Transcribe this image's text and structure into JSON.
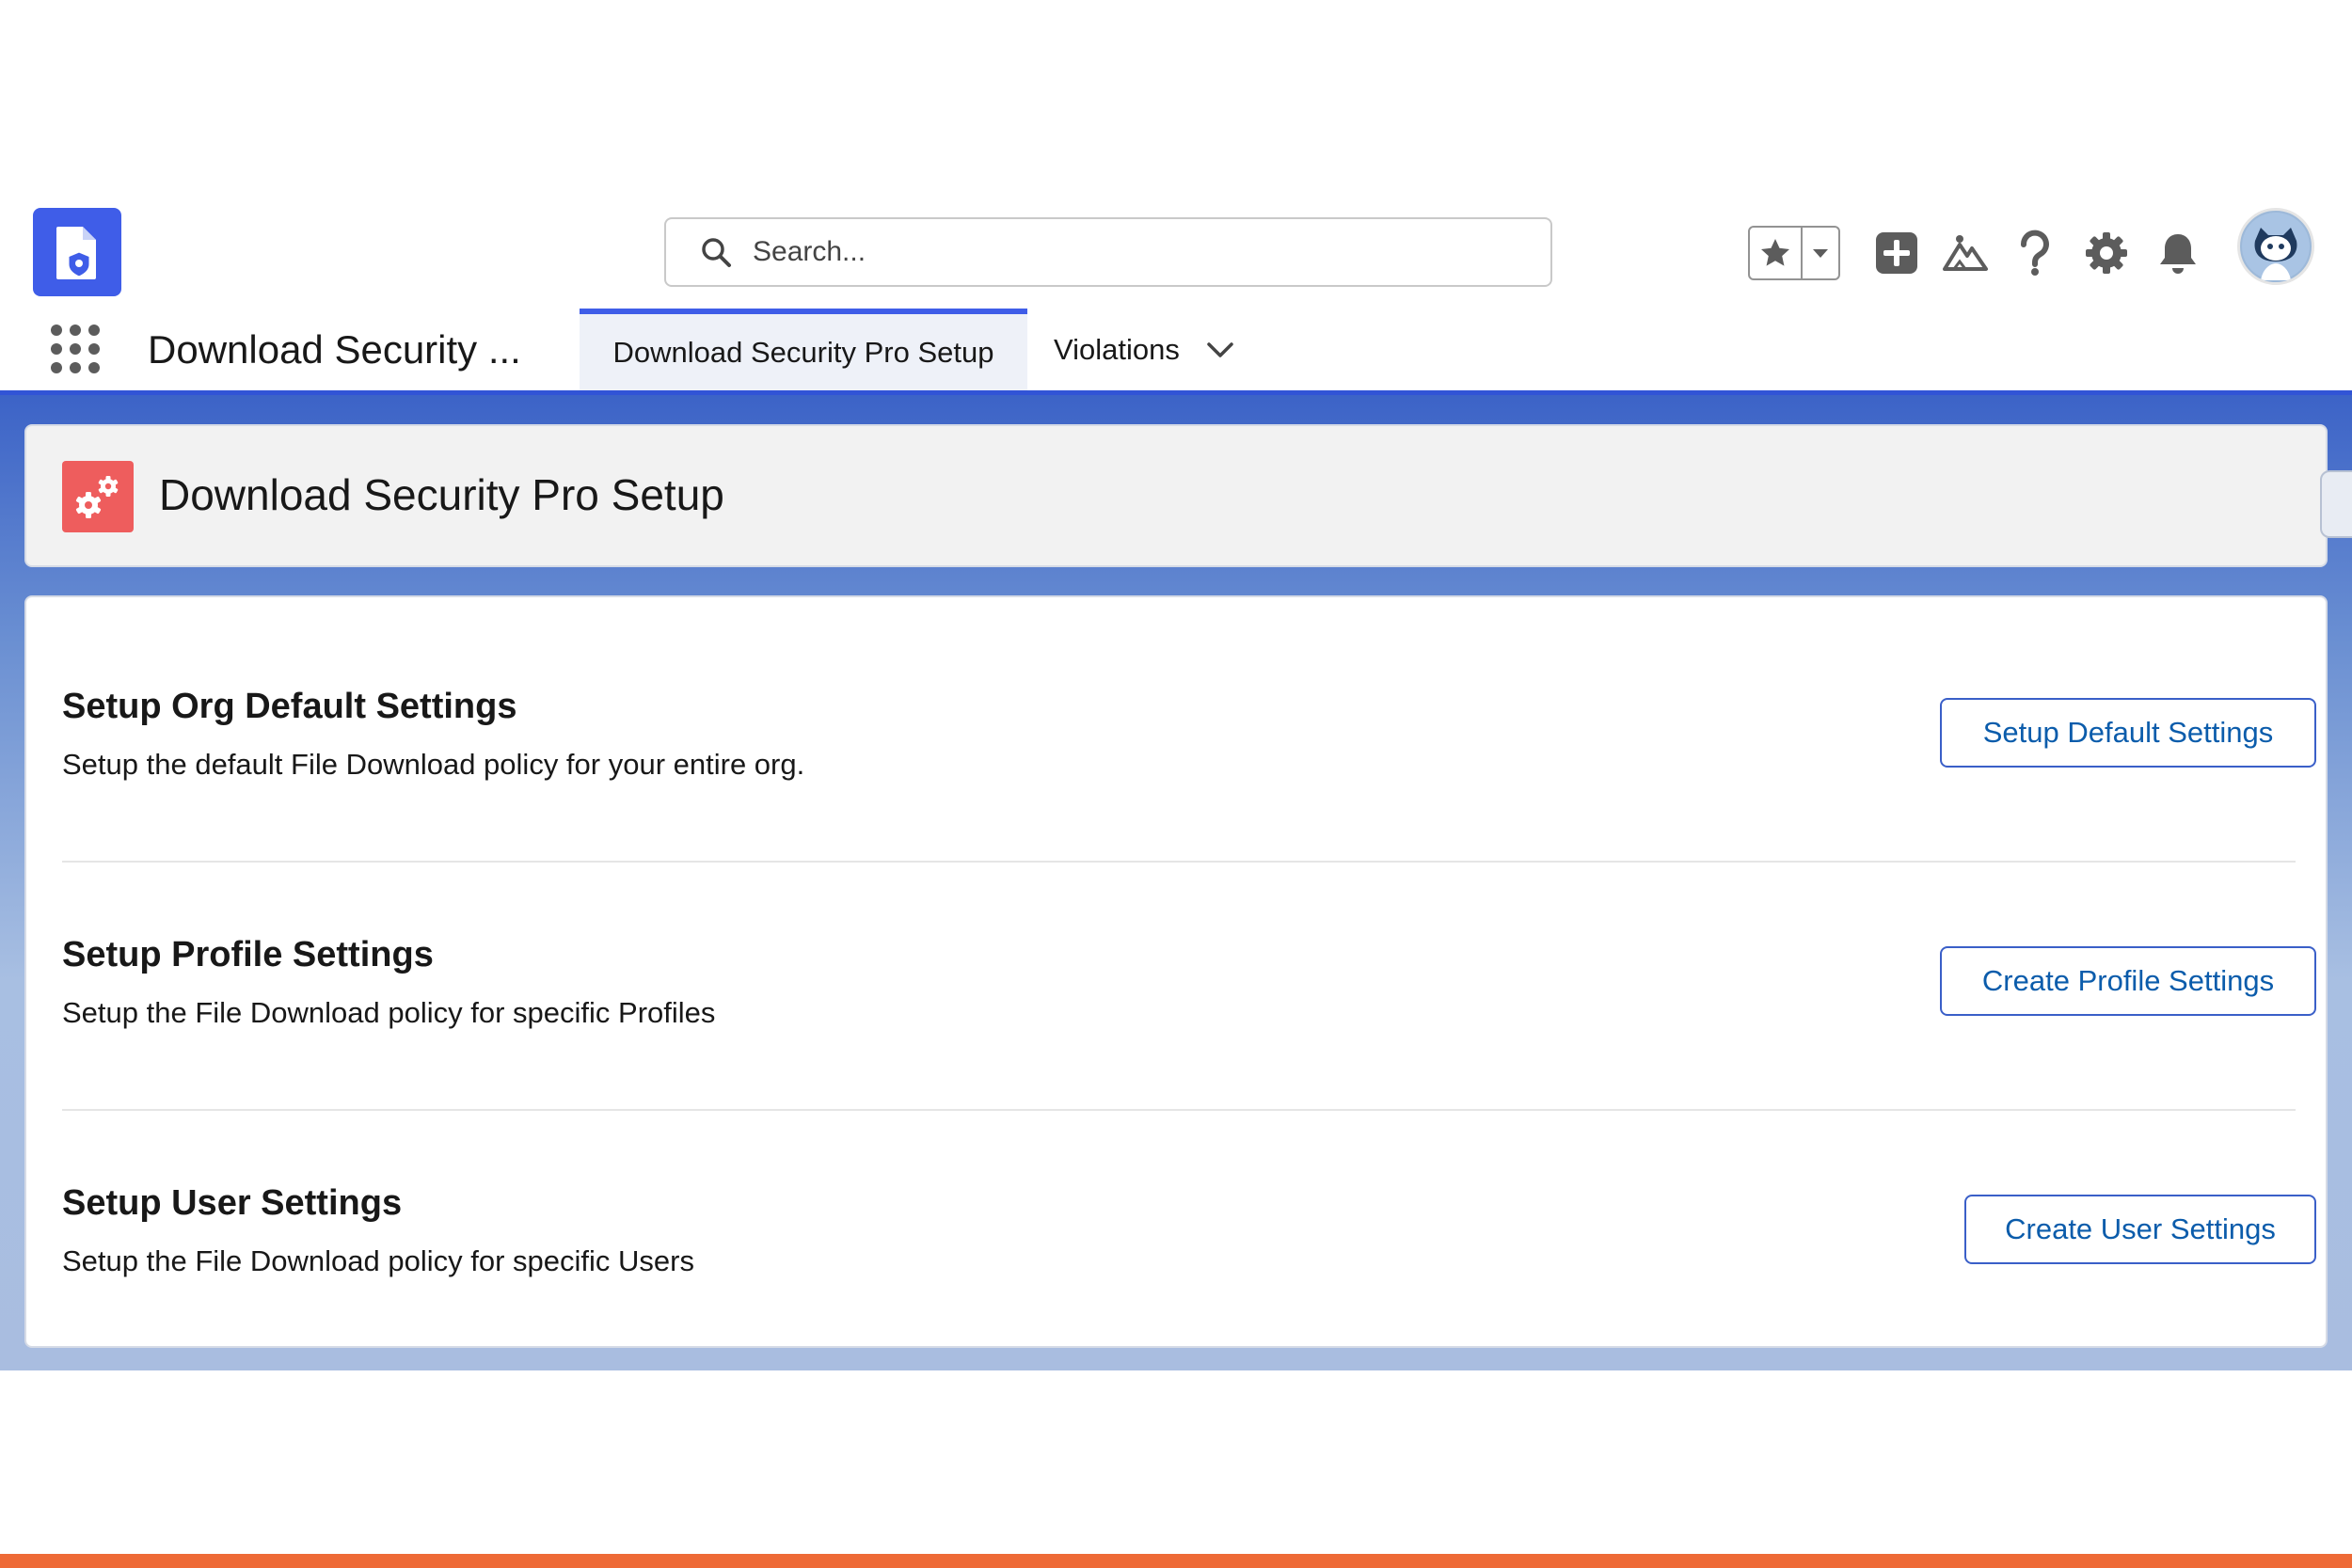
{
  "header": {
    "app_logo_icon": "file-shield-icon",
    "search": {
      "placeholder": "Search..."
    },
    "icons": [
      "star-icon",
      "chevron-down-icon",
      "add-icon",
      "trailhead-icon",
      "help-icon",
      "gear-icon",
      "bell-icon",
      "avatar"
    ]
  },
  "nav": {
    "app_name": "Download Security ...",
    "tabs": [
      {
        "label": "Download Security Pro Setup",
        "active": true
      },
      {
        "label": "Violations",
        "active": false,
        "has_dropdown": true
      }
    ]
  },
  "page_header": {
    "icon": "gears-icon",
    "title": "Download Security Pro Setup"
  },
  "sections": [
    {
      "title": "Setup Org Default Settings",
      "description": "Setup the default File Download policy for your entire org.",
      "button_label": "Setup Default Settings"
    },
    {
      "title": "Setup Profile Settings",
      "description": "Setup the File Download policy for specific Profiles",
      "button_label": "Create Profile Settings"
    },
    {
      "title": "Setup User Settings",
      "description": "Setup the File Download policy for specific Users",
      "button_label": "Create User Settings"
    }
  ],
  "colors": {
    "brand_blue": "#3f5de8",
    "link_blue": "#0b5cab",
    "header_icon_red": "#ee5d5d",
    "bottom_strip": "#ee6a36"
  }
}
